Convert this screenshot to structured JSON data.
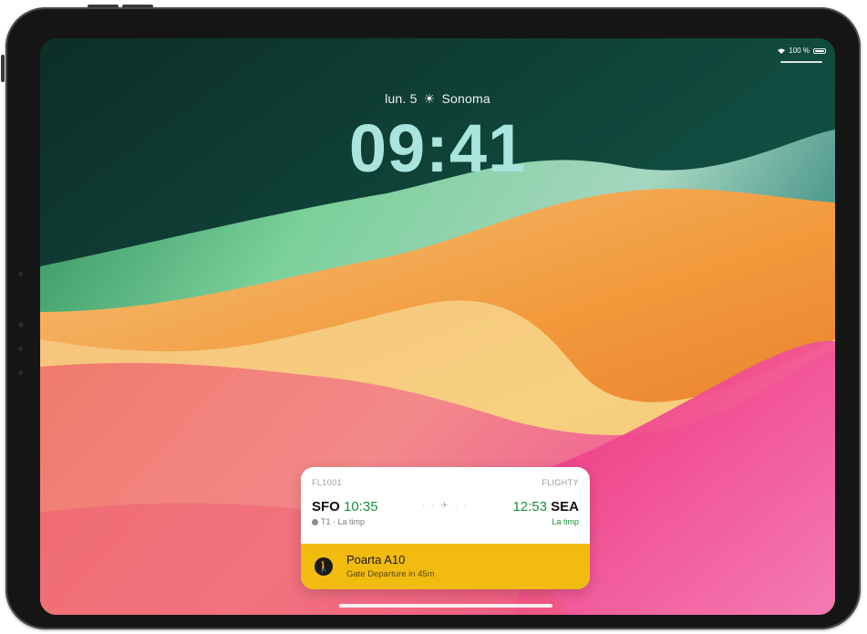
{
  "status_bar": {
    "battery_percent": "100 %"
  },
  "lock_screen": {
    "day": "lun. 5",
    "weather_icon": "sun-icon",
    "location": "Sonoma",
    "time": "09:41"
  },
  "widget": {
    "flight_number": "FL1001",
    "app_name": "FLIGHTY",
    "origin_code": "SFO",
    "departure_time": "10:35",
    "arrival_time": "12:53",
    "destination_code": "SEA",
    "origin_terminal": "T1 · La timp",
    "arrival_status": "La timp",
    "gate": "Poarta A10",
    "gate_departure": "Gate Departure in 45m",
    "accent_color": "#f1bb10",
    "status_color": "#1c8f3c"
  }
}
